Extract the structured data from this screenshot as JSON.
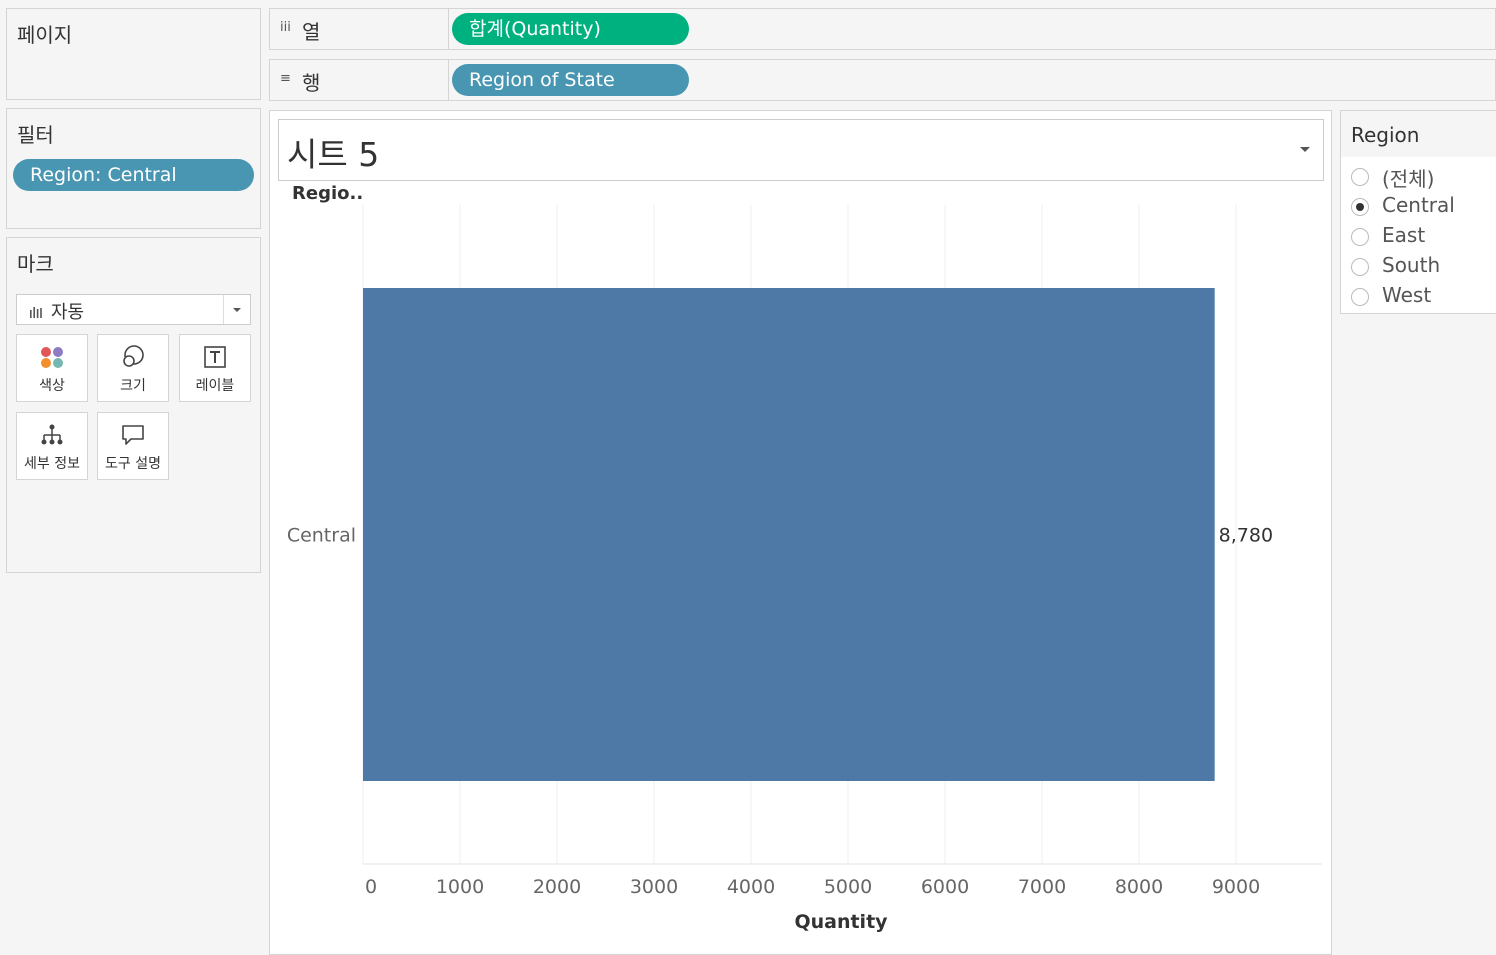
{
  "pages_panel": {
    "title": "페이지"
  },
  "filters_panel": {
    "title": "필터",
    "pill": "Region: Central"
  },
  "marks_panel": {
    "title": "마크",
    "mark_type": "자동",
    "cards": [
      {
        "label": "색상",
        "icon": "color-icon"
      },
      {
        "label": "크기",
        "icon": "size-icon"
      },
      {
        "label": "레이블",
        "icon": "label-icon"
      },
      {
        "label": "세부 정보",
        "icon": "detail-icon"
      },
      {
        "label": "도구 설명",
        "icon": "tooltip-icon"
      }
    ]
  },
  "shelves": {
    "columns": {
      "label": "열",
      "pill": "합계(Quantity)"
    },
    "rows": {
      "label": "행",
      "pill": "Region of State"
    }
  },
  "sheet": {
    "title": "시트 5",
    "row_header": "Regio.."
  },
  "chart_data": {
    "type": "bar",
    "orientation": "horizontal",
    "categories": [
      "Central"
    ],
    "values": [
      8780
    ],
    "data_labels": [
      "8,780"
    ],
    "xlabel": "Quantity",
    "xlim": [
      0,
      9850
    ],
    "xticks": [
      0,
      1000,
      2000,
      3000,
      4000,
      5000,
      6000,
      7000,
      8000,
      9000
    ],
    "grid": true,
    "bar_color": "#4e79a7"
  },
  "region_legend": {
    "title": "Region",
    "options": [
      "(전체)",
      "Central",
      "East",
      "South",
      "West"
    ],
    "selected": "Central"
  },
  "colors": {
    "green_pill": "#00b180",
    "blue_pill": "#4996b2",
    "bar": "#4e79a7"
  }
}
